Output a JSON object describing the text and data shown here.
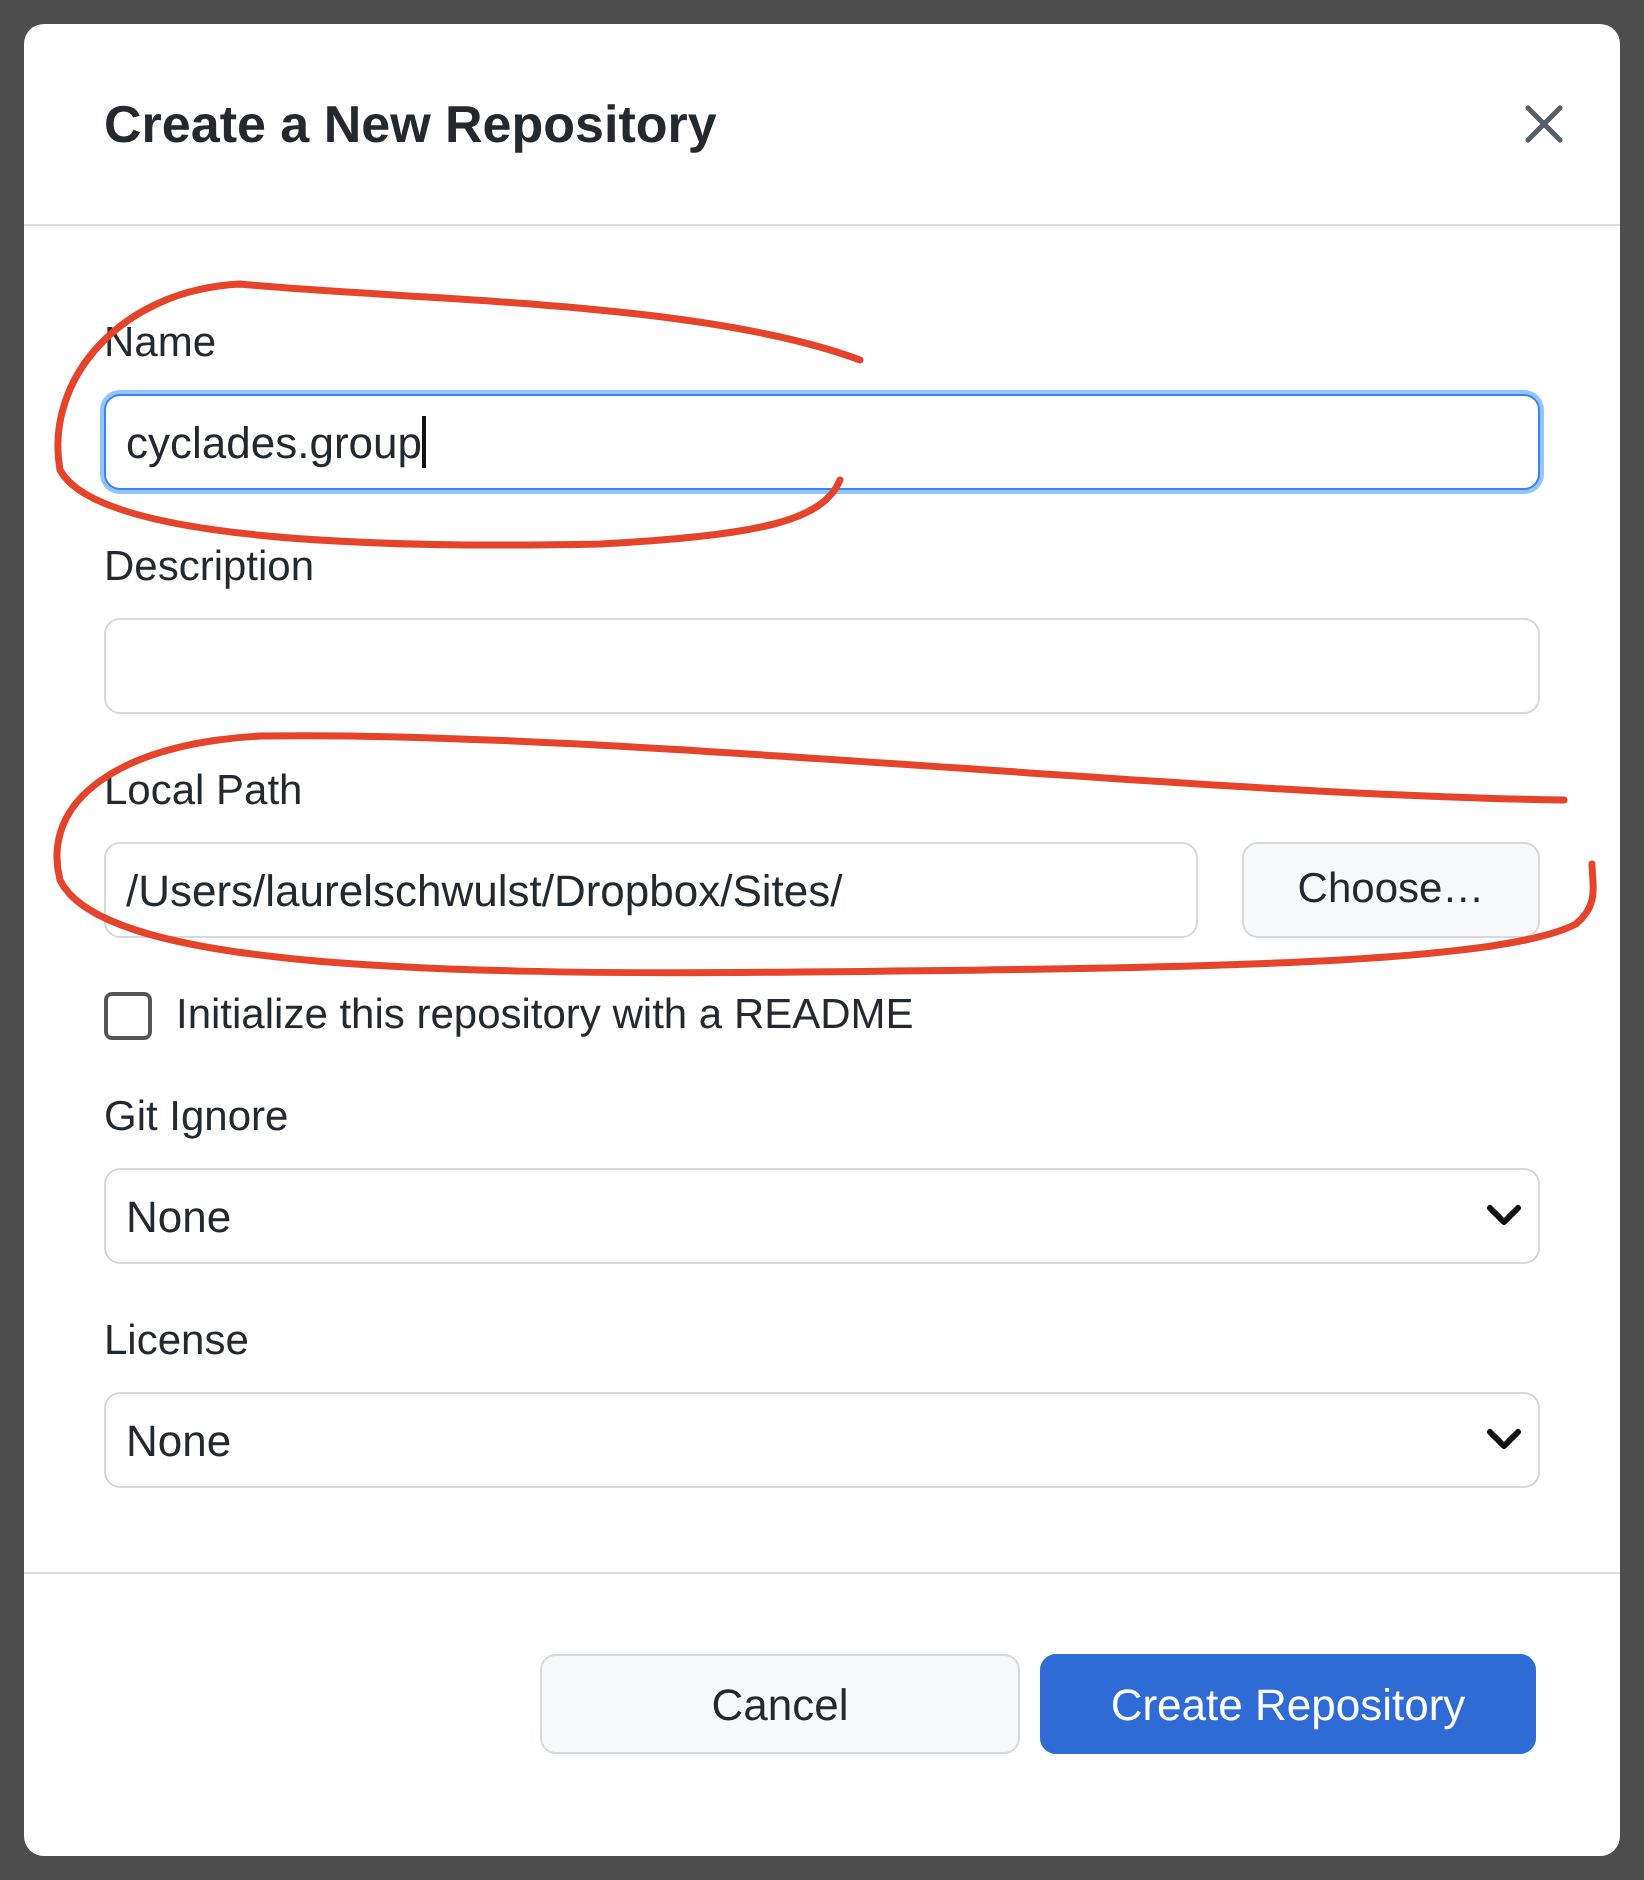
{
  "dialog": {
    "title": "Create a New Repository"
  },
  "fields": [
    {
      "kind": "text",
      "label": "Name",
      "value": "cyclades.group",
      "focused": true
    },
    {
      "kind": "text",
      "label": "Description",
      "focused": false
    },
    {
      "kind": "path",
      "label": "Local Path",
      "value": "/Users/laurelschwulst/Dropbox/Sites/",
      "button": "Choose…",
      "focused": false
    },
    {
      "kind": "checkbox",
      "label": "Initialize this repository with a README",
      "checked": false
    },
    {
      "kind": "select",
      "label": "Git Ignore",
      "value": "None"
    },
    {
      "kind": "select",
      "label": "License",
      "value": "None"
    }
  ],
  "buttons": [
    {
      "label": "Cancel",
      "primary": false
    },
    {
      "label": "Create Repository",
      "primary": true
    }
  ],
  "annotations": [
    {
      "kind": "loop"
    },
    {
      "kind": "loop"
    }
  ]
}
